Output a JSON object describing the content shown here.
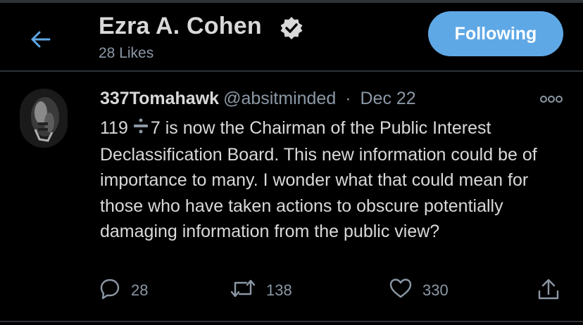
{
  "header": {
    "name": "Ezra A. Cohen",
    "subtitle": "28 Likes",
    "follow_label": "Following"
  },
  "tweet": {
    "author": "337Tomahawk",
    "handle": "@absitminded",
    "date_sep": "·",
    "date": "Dec 22",
    "text_lead": "119",
    "text_rest": "7 is now the Chairman of the Public Interest Declassification Board. This new information could be of importance to many. I wonder what that could mean for those who have taken actions to obscure potentially damaging information from the public view?",
    "replies": "28",
    "retweets": "138",
    "likes": "330"
  },
  "colors": {
    "background": "#000000",
    "accent": "#5fa8e6",
    "muted": "#8b98a5",
    "text": "#d9d9d9"
  },
  "icons": [
    "back-arrow-icon",
    "verified-badge-icon",
    "more-options-icon",
    "divide-icon",
    "reply-icon",
    "retweet-icon",
    "like-icon",
    "share-icon"
  ]
}
